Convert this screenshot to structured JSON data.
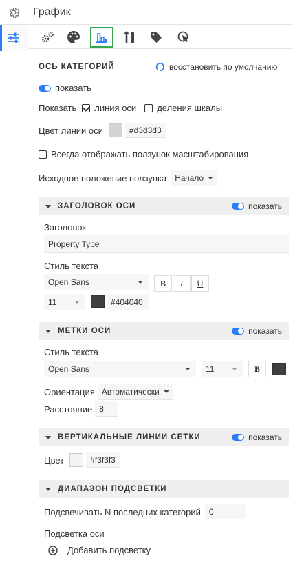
{
  "header": {
    "title": "График"
  },
  "icons": {
    "settings": "gear-icon",
    "active_rail": "sliders-icon",
    "toolbar": [
      "gears-icon",
      "palette-icon",
      "bar-chart-icon",
      "axes-icon",
      "tag-icon",
      "cursor-icon"
    ]
  },
  "colors": {
    "accent": "#2d7df6",
    "selected_border": "#36a64f"
  },
  "category_axis": {
    "title": "ОСЬ КАТЕГОРИЙ",
    "reset": "восстановить по умолчанию",
    "show_label": "показать",
    "show_prefix": "Показать",
    "axis_line": "линия оси",
    "axis_line_checked": true,
    "ticks": "деления шкалы",
    "ticks_checked": false,
    "line_color_label": "Цвет линии оси",
    "line_color": "#d3d3d3",
    "always_slider": "Всегда отображать ползунок масштабирования",
    "slider_position_label": "Исходное положение ползунка",
    "slider_position": "Начало"
  },
  "axis_title_section": {
    "title": "ЗАГОЛОВОК ОСИ",
    "show": "показать",
    "heading_label": "Заголовок",
    "heading_value": "Property Type",
    "text_style_label": "Стиль текста",
    "font": "Open Sans",
    "bold": "B",
    "italic": "I",
    "underline": "U",
    "size": "11",
    "color": "#404040"
  },
  "axis_labels_section": {
    "title": "МЕТКИ ОСИ",
    "show": "показать",
    "text_style_label": "Стиль текста",
    "font": "Open Sans",
    "size": "11",
    "bold": "B",
    "orientation_label": "Ориентация",
    "orientation": "Автоматически",
    "distance_label": "Расстояние",
    "distance": "8"
  },
  "gridlines_section": {
    "title": "ВЕРТИКАЛЬНЫЕ ЛИНИИ СЕТКИ",
    "show": "показать",
    "color_label": "Цвет",
    "color": "#f3f3f3"
  },
  "highlight_section": {
    "title": "ДИАПАЗОН ПОДСВЕТКИ",
    "last_n_label": "Подсвечивать N последних категорий",
    "last_n": "0",
    "axis_highlight_label": "Подсветка оси",
    "add_label": "Добавить подсветку"
  }
}
